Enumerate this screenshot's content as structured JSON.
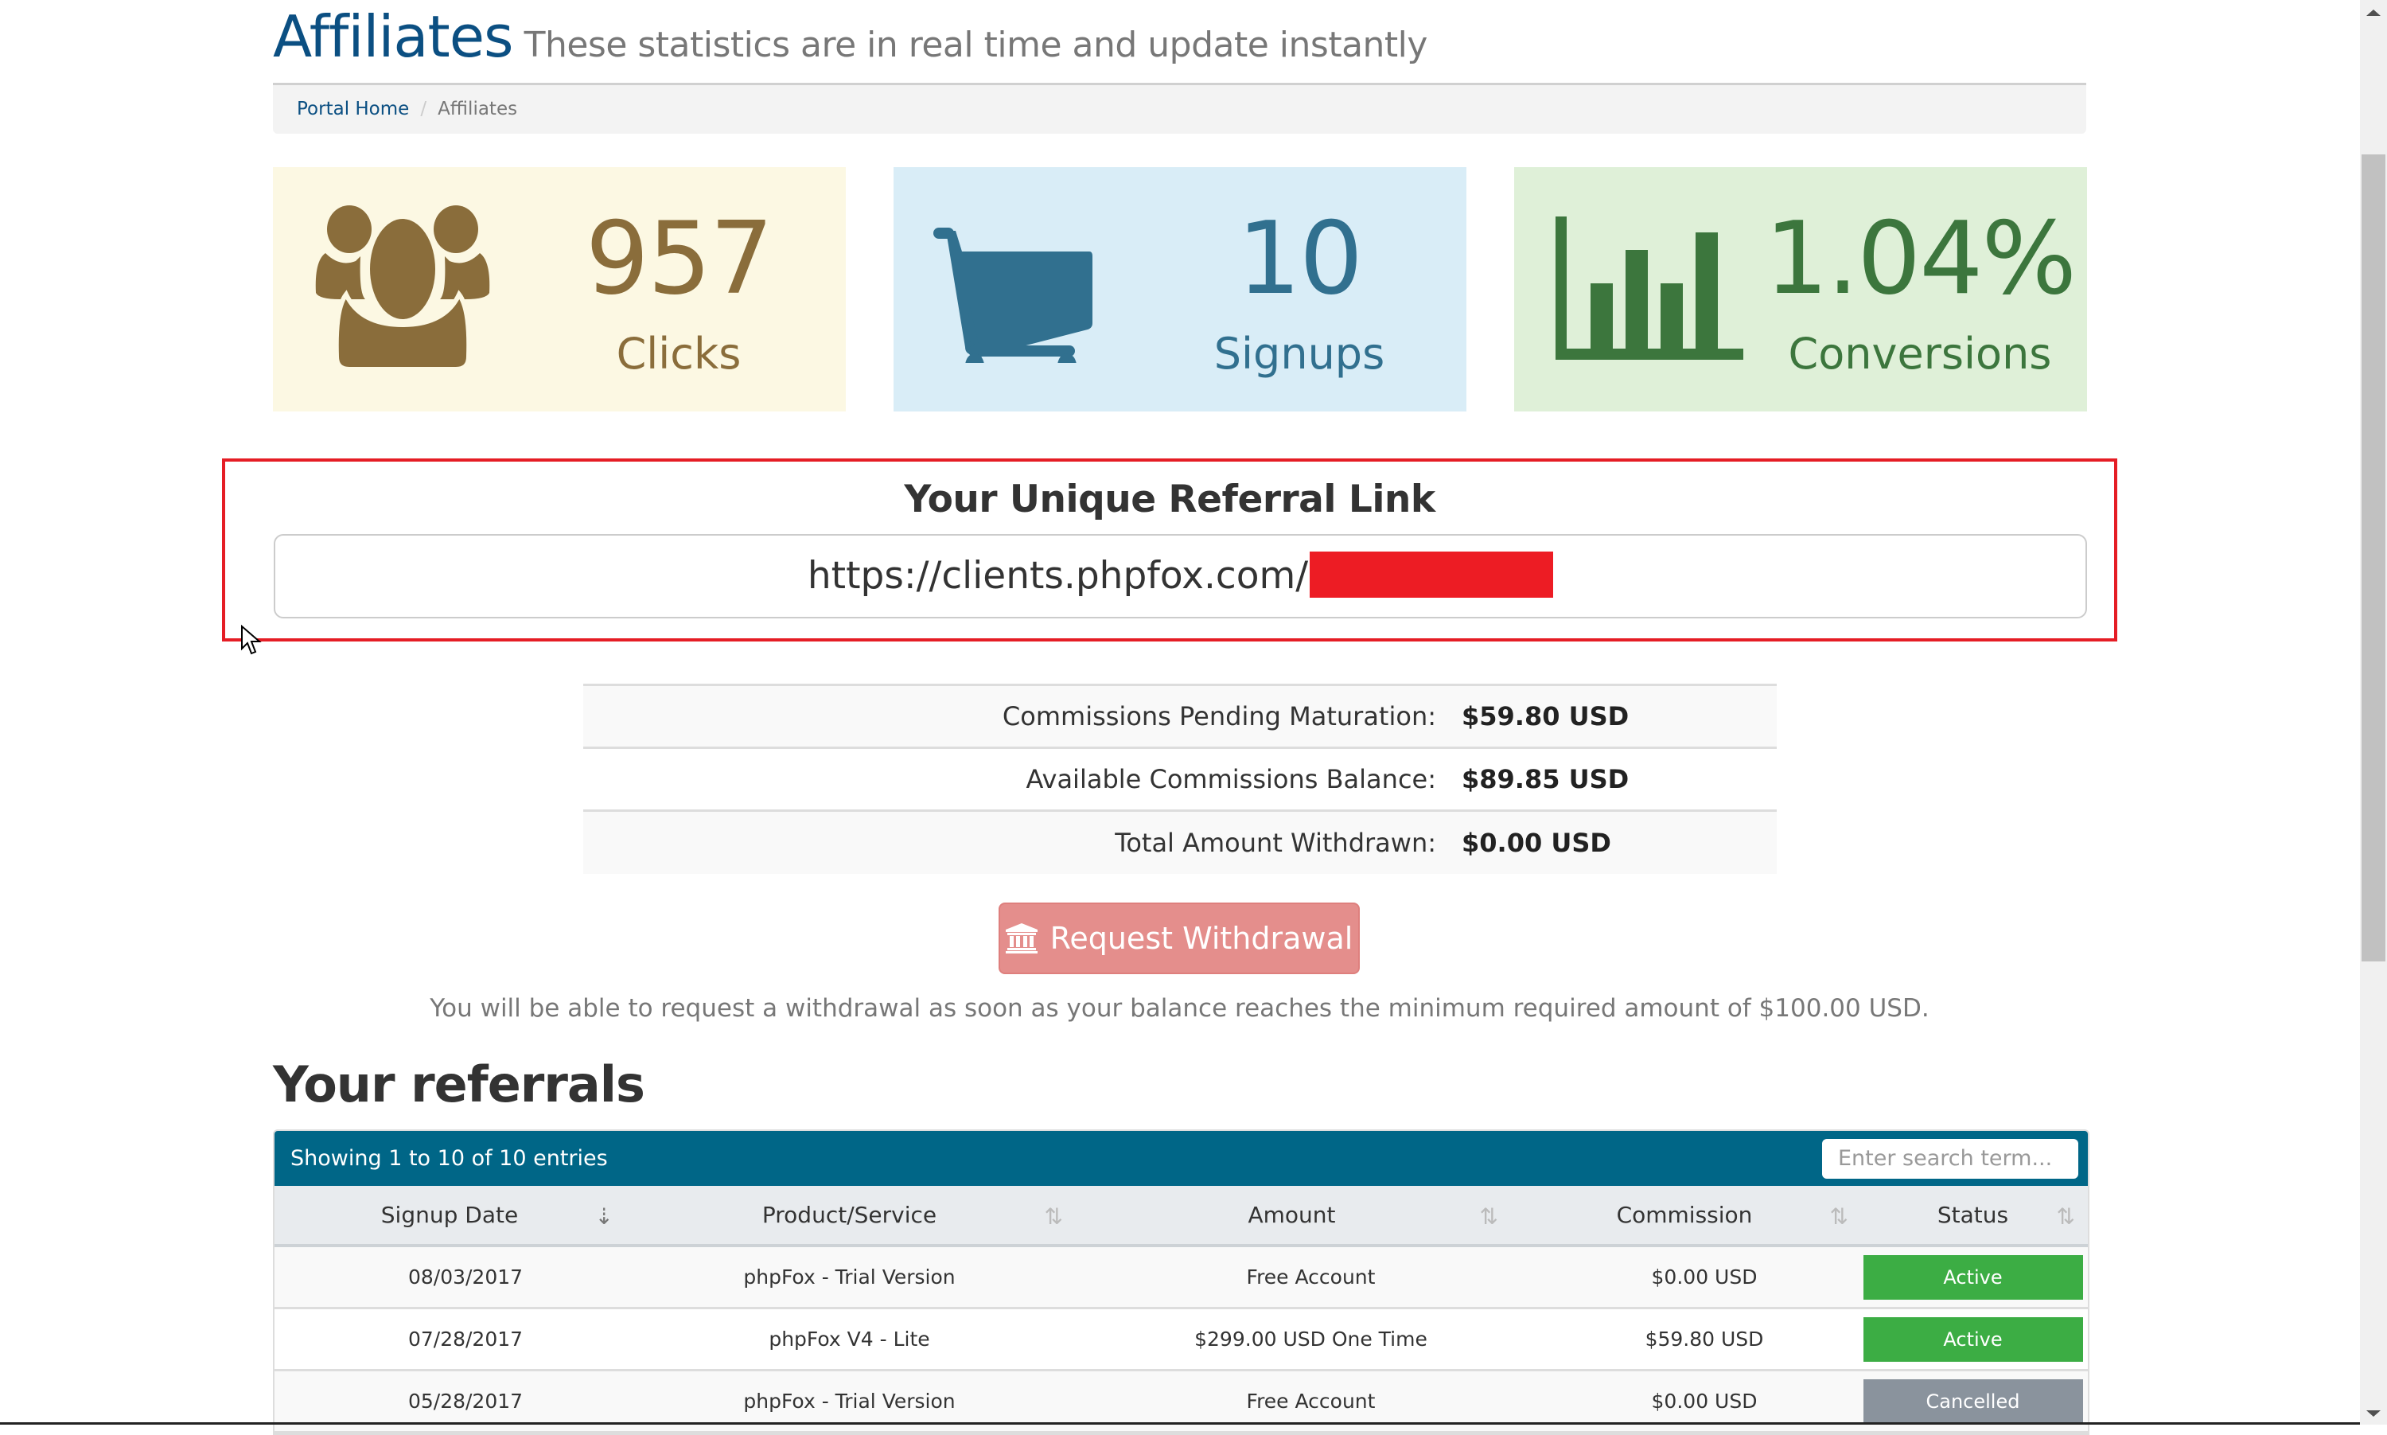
{
  "header": {
    "title": "Affiliates",
    "subtitle": "These statistics are in real time and update instantly"
  },
  "breadcrumb": {
    "items": [
      {
        "label": "Portal Home",
        "link": true
      },
      {
        "label": "Affiliates",
        "link": false
      }
    ],
    "separator": "/"
  },
  "stats": {
    "clicks": {
      "value": "957",
      "label": "Clicks",
      "icon": "users-icon",
      "color": "#8a6d3b",
      "bg": "#fcf8e3"
    },
    "signups": {
      "value": "10",
      "label": "Signups",
      "icon": "shopping-cart-icon",
      "color": "#31708f",
      "bg": "#d9edf7"
    },
    "conversions": {
      "value": "1.04%",
      "label": "Conversions",
      "icon": "bar-chart-icon",
      "color": "#3c763d",
      "bg": "#dff0d8"
    }
  },
  "referral": {
    "title": "Your Unique Referral Link",
    "url_visible": "https://clients.phpfox.com/",
    "redacted": true
  },
  "commissions": [
    {
      "label": "Commissions Pending Maturation:",
      "value": "$59.80 USD"
    },
    {
      "label": "Available Commissions Balance:",
      "value": "$89.85 USD"
    },
    {
      "label": "Total Amount Withdrawn:",
      "value": "$0.00 USD"
    }
  ],
  "withdraw": {
    "button_label": "Request Withdrawal",
    "icon": "bank-icon",
    "disabled": true,
    "note": "You will be able to request a withdrawal as soon as your balance reaches the minimum required amount of $100.00 USD."
  },
  "referrals": {
    "heading": "Your referrals",
    "info": "Showing 1 to 10 of 10 entries",
    "search_placeholder": "Enter search term...",
    "columns": [
      "Signup Date",
      "Product/Service",
      "Amount",
      "Commission",
      "Status"
    ],
    "rows": [
      {
        "date": "08/03/2017",
        "product": "phpFox - Trial Version",
        "amount": "Free Account",
        "commission": "$0.00 USD",
        "status": "Active",
        "status_color": "#3cad44"
      },
      {
        "date": "07/28/2017",
        "product": "phpFox V4 - Lite",
        "amount": "$299.00 USD One Time",
        "commission": "$59.80 USD",
        "status": "Active",
        "status_color": "#3cad44"
      },
      {
        "date": "05/28/2017",
        "product": "phpFox - Trial Version",
        "amount": "Free Account",
        "commission": "$0.00 USD",
        "status": "Cancelled",
        "status_color": "#8a939d"
      }
    ]
  },
  "colors": {
    "brand": "#0b4f82",
    "table_header": "#006687",
    "highlight_border": "#e51d25",
    "withdraw_button": "#e48e8c"
  }
}
